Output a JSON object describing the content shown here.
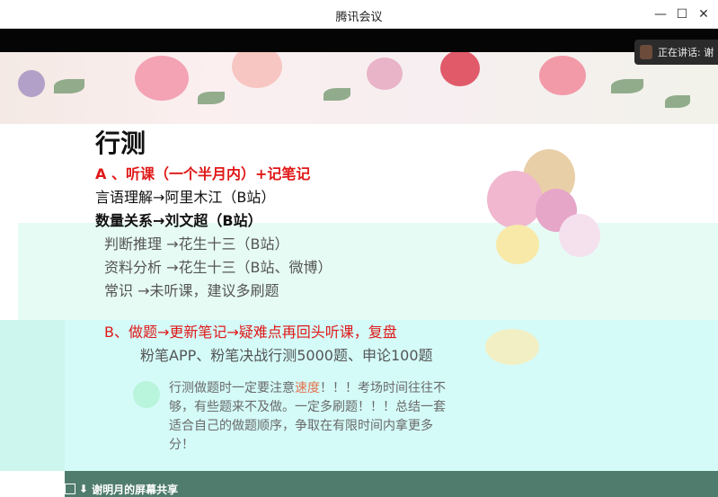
{
  "window": {
    "title": "腾讯会议",
    "controls": [
      "—",
      "☐",
      "✕"
    ]
  },
  "speaking": {
    "label": "正在讲话: 谢"
  },
  "slide": {
    "heading": "行测",
    "line_a": "A 、听课（一个半月内）+记笔记",
    "line_1": "言语理解→阿里木江（B站）",
    "line_2": "数量关系→刘文超（B站）",
    "line_3": "判断推理 →花生十三（B站）",
    "line_4": "资料分析 →花生十三（B站、微博）",
    "line_5": "常识 →未听课，建议多刷题",
    "line_b": "B、做题→更新笔记→疑难点再回头听课，复盘",
    "line_6": "粉笔APP、粉笔决战行测5000题、申论100题",
    "tip_part1": "行测做题时一定要注意",
    "tip_accent": "速度",
    "tip_part2": "！！！考场时间往往不够，有些题来不及做。一定多刷题！！！总结一套适合自己的做题顺序，争取在有限时间内拿更多分！"
  },
  "share": {
    "label": "谢明月的屏幕共享"
  },
  "colors": {
    "accent_red": "#e01818",
    "share_bar": "#4f7c6d",
    "mint": "#d4fbf8"
  }
}
